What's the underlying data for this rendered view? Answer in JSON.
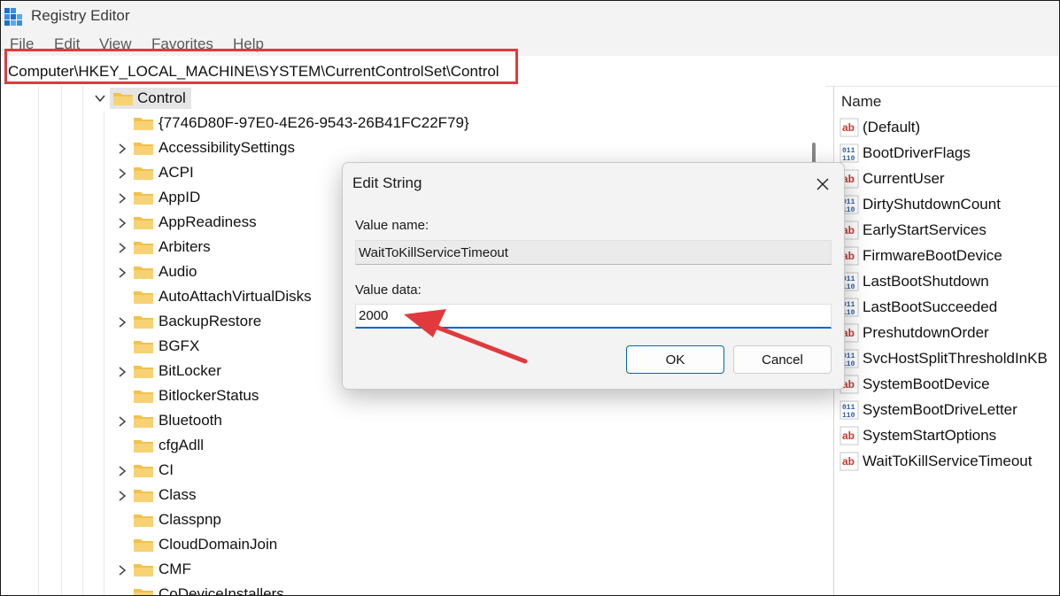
{
  "app": {
    "title": "Registry Editor"
  },
  "menu": [
    "File",
    "Edit",
    "View",
    "Favorites",
    "Help"
  ],
  "address": {
    "path": "Computer\\HKEY_LOCAL_MACHINE\\SYSTEM\\CurrentControlSet\\Control"
  },
  "tree": {
    "selected": {
      "label": "Control"
    },
    "children": [
      {
        "label": "{7746D80F-97E0-4E26-9543-26B41FC22F79}",
        "expandable": false
      },
      {
        "label": "AccessibilitySettings",
        "expandable": true
      },
      {
        "label": "ACPI",
        "expandable": true
      },
      {
        "label": "AppID",
        "expandable": true
      },
      {
        "label": "AppReadiness",
        "expandable": true
      },
      {
        "label": "Arbiters",
        "expandable": true
      },
      {
        "label": "Audio",
        "expandable": true
      },
      {
        "label": "AutoAttachVirtualDisks",
        "expandable": false
      },
      {
        "label": "BackupRestore",
        "expandable": true
      },
      {
        "label": "BGFX",
        "expandable": false
      },
      {
        "label": "BitLocker",
        "expandable": true
      },
      {
        "label": "BitlockerStatus",
        "expandable": false
      },
      {
        "label": "Bluetooth",
        "expandable": true
      },
      {
        "label": "cfgAdll",
        "expandable": false
      },
      {
        "label": "CI",
        "expandable": true
      },
      {
        "label": "Class",
        "expandable": true
      },
      {
        "label": "Classpnp",
        "expandable": false
      },
      {
        "label": "CloudDomainJoin",
        "expandable": false
      },
      {
        "label": "CMF",
        "expandable": true
      },
      {
        "label": "CoDeviceInstallers",
        "expandable": false
      }
    ]
  },
  "values": {
    "column_name": "Name",
    "items": [
      {
        "name": "(Default)",
        "kind": "string"
      },
      {
        "name": "BootDriverFlags",
        "kind": "binary"
      },
      {
        "name": "CurrentUser",
        "kind": "string"
      },
      {
        "name": "DirtyShutdownCount",
        "kind": "binary"
      },
      {
        "name": "EarlyStartServices",
        "kind": "string"
      },
      {
        "name": "FirmwareBootDevice",
        "kind": "string"
      },
      {
        "name": "LastBootShutdown",
        "kind": "binary"
      },
      {
        "name": "LastBootSucceeded",
        "kind": "binary"
      },
      {
        "name": "PreshutdownOrder",
        "kind": "string"
      },
      {
        "name": "SvcHostSplitThresholdInKB",
        "kind": "binary"
      },
      {
        "name": "SystemBootDevice",
        "kind": "string"
      },
      {
        "name": "SystemBootDriveLetter",
        "kind": "binary"
      },
      {
        "name": "SystemStartOptions",
        "kind": "string"
      },
      {
        "name": "WaitToKillServiceTimeout",
        "kind": "string"
      }
    ]
  },
  "dialog": {
    "title": "Edit String",
    "value_name_label": "Value name:",
    "value_name": "WaitToKillServiceTimeout",
    "value_data_label": "Value data:",
    "value_data": "2000",
    "ok_label": "OK",
    "cancel_label": "Cancel"
  },
  "colors": {
    "annotation": "#e03a3e",
    "accent": "#0067c0",
    "folder": "#f2c14e",
    "string_icon": "#c8382e",
    "binary_icon": "#2f5fa8"
  }
}
